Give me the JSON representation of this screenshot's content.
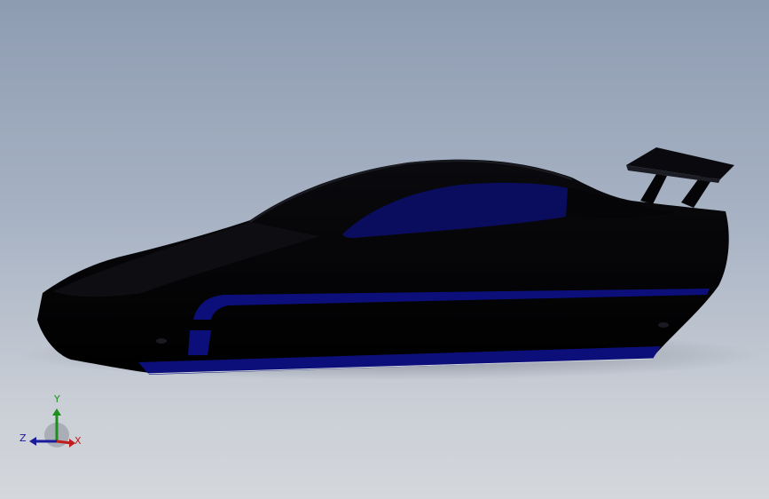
{
  "viewport": {
    "background_top": "#8e9cb2",
    "background_bottom": "#d4d7db"
  },
  "model": {
    "body_color": "#020205",
    "accent_color": "#0c0f7a",
    "window_color": "#0a0c5e"
  },
  "triad": {
    "x_label": "X",
    "y_label": "Y",
    "z_label": "Z",
    "x_color": "#c21d1d",
    "y_color": "#1d8f1d",
    "z_color": "#1a1a9c"
  }
}
